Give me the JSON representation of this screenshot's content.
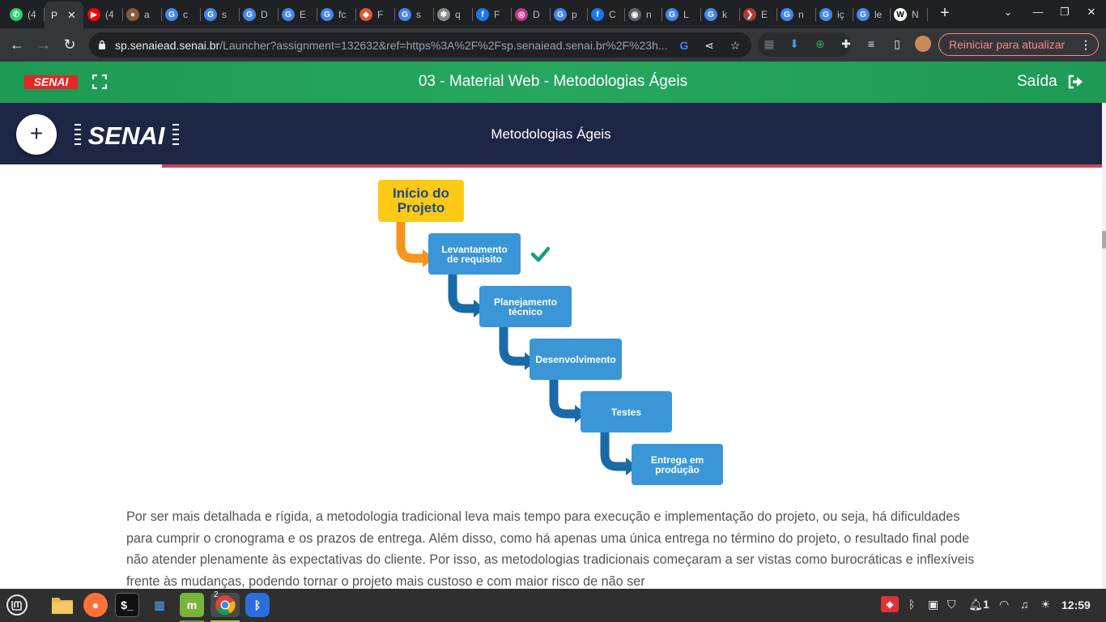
{
  "browser": {
    "tabs": [
      {
        "title": "(4",
        "color": "#25d366",
        "glyph": "✆"
      },
      {
        "title": "P",
        "active": true
      },
      {
        "title": "(4",
        "color": "#ff0000",
        "glyph": "▶"
      },
      {
        "title": "a",
        "color": "#8a5a3c",
        "glyph": "●"
      },
      {
        "title": "c",
        "color": "#4285f4",
        "glyph": "G"
      },
      {
        "title": "s",
        "color": "#4285f4",
        "glyph": "G"
      },
      {
        "title": "D",
        "color": "#4285f4",
        "glyph": "G"
      },
      {
        "title": "E",
        "color": "#4285f4",
        "glyph": "G"
      },
      {
        "title": "fc",
        "color": "#4285f4",
        "glyph": "G"
      },
      {
        "title": "F",
        "color": "#e2572c",
        "glyph": "◆"
      },
      {
        "title": "s",
        "color": "#4285f4",
        "glyph": "G"
      },
      {
        "title": "q",
        "color": "#888888",
        "glyph": "✱"
      },
      {
        "title": "F",
        "color": "#1877f2",
        "glyph": "f"
      },
      {
        "title": "D",
        "color": "#c13584",
        "glyph": "◎"
      },
      {
        "title": "p",
        "color": "#4285f4",
        "glyph": "G"
      },
      {
        "title": "C",
        "color": "#1877f2",
        "glyph": "f"
      },
      {
        "title": "n",
        "color": "#5f6368",
        "glyph": "◉"
      },
      {
        "title": "L",
        "color": "#4285f4",
        "glyph": "G"
      },
      {
        "title": "k",
        "color": "#4285f4",
        "glyph": "G"
      },
      {
        "title": "E",
        "color": "#b33a3a",
        "glyph": "❯"
      },
      {
        "title": "n",
        "color": "#4285f4",
        "glyph": "G"
      },
      {
        "title": "iç",
        "color": "#4285f4",
        "glyph": "G"
      },
      {
        "title": "le",
        "color": "#4285f4",
        "glyph": "G"
      },
      {
        "title": "N",
        "color": "#ffffff",
        "glyph": "W"
      }
    ],
    "url_host": "sp.senaiead.senai.br",
    "url_path": "/Launcher?assignment=132632&ref=https%3A%2F%2Fsp.senaiead.senai.br%2F%23h...",
    "update_label": "Reiniciar para atualizar"
  },
  "course": {
    "logo": "SENAI",
    "title": "03 - Material Web - Metodologias Ágeis",
    "exit_label": "Saída"
  },
  "content_bar": {
    "logo": "SENAI",
    "title": "Metodologias Ágeis",
    "progress_fraction": 0.147
  },
  "diagram": {
    "start": "Início do\nProjeto",
    "steps": [
      "Levantamento\nde requisito",
      "Planejamento\ntécnico",
      "Desenvolvimento",
      "Testes",
      "Entrega em\nprodução"
    ],
    "colors": {
      "start": "#fcc914",
      "step": "#3a96d7",
      "arrow_start": "#f7941d",
      "arrow": "#1a6aa8",
      "check": "#16a085"
    }
  },
  "paragraph": "Por ser mais detalhada e rígida, a metodologia tradicional leva mais tempo para execução e implementação do projeto, ou seja, há dificuldades para cumprir o cronograma e os prazos de entrega. Além disso, como há apenas uma única entrega no término do projeto, o resultado final pode não atender plenamente às expectativas do cliente. Por isso, as metodologias tradicionais começaram a ser vistas como burocráticas e inflexíveis frente às mudanças, podendo tornar o projeto mais custoso e com maior risco de não ser",
  "taskbar": {
    "workspace_badge": "2",
    "notification_count": "1",
    "clock": "12:59"
  }
}
